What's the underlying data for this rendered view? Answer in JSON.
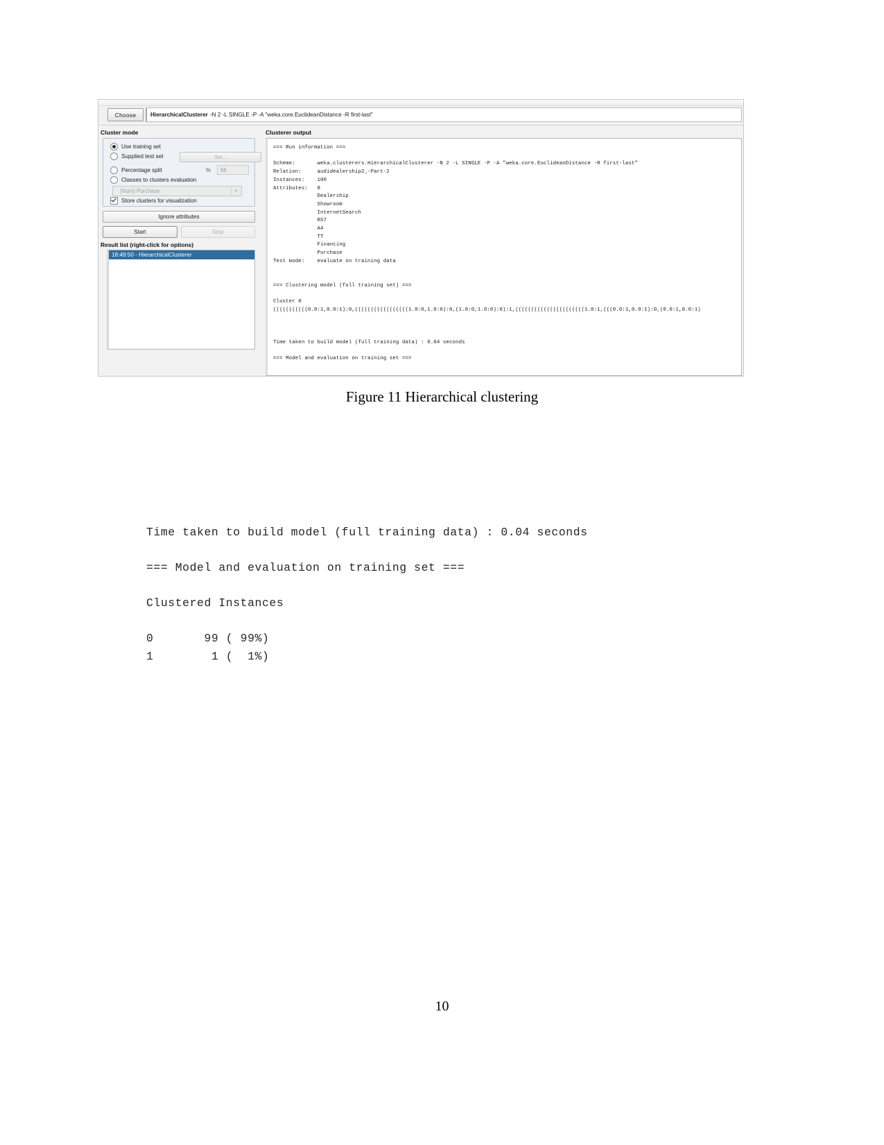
{
  "document": {
    "page_number": "10",
    "figure_caption": "Figure 11 Hierarchical clustering"
  },
  "weka": {
    "toolbar": {
      "choose_label": "Choose",
      "scheme_name": "HierarchicalClusterer",
      "scheme_options": "-N 2 -L SINGLE -P -A \"weka.core.EuclideanDistance -R first-last\""
    },
    "cluster_mode": {
      "title": "Cluster mode",
      "options": [
        {
          "label": "Use training set",
          "selected": true
        },
        {
          "label": "Supplied test set",
          "selected": false
        },
        {
          "label": "Percentage split",
          "selected": false
        },
        {
          "label": "Classes to clusters evaluation",
          "selected": false
        }
      ],
      "set_button": "Set...",
      "percent_symbol": "%",
      "percent_value": "66",
      "class_combo_value": "(Num) Purchase",
      "store_clusters_label": "Store clusters for visualization",
      "store_clusters_checked": true,
      "ignore_attributes_button": "Ignore attributes",
      "start_button": "Start",
      "stop_button": "Stop"
    },
    "result_list": {
      "title": "Result list (right-click for options)",
      "items": [
        "18:49:50 - HierarchicalClusterer"
      ]
    },
    "output": {
      "title": "Clusterer output",
      "text": "=== Run information ===\n\nScheme:       weka.clusterers.HierarchicalClusterer -N 2 -L SINGLE -P -A \"weka.core.EuclideanDistance -R first-last\"\nRelation:     audidealership2_-Part-2\nInstances:    100\nAttributes:   8\n              Dealership\n              Showroom\n              InternetSearch\n              RS7\n              A4\n              TT\n              Financing\n              Purchase\nTest mode:    evaluate on training data\n\n\n=== Clustering model (full training set) ===\n\nCluster 0\n(((((((((((0.0:1,0.0:1):0,(((((((((((((((((1.0:0,1.0:0):0,(1.0:0,1.0:0):0):1,((((((((((((((((((((((1.0:1,(((0.0:1,0.0:1):0,(0.0:1,0.0:1)\n\n\n\nTime taken to build model (full training data) : 0.04 seconds\n\n=== Model and evaluation on training set ==="
    }
  },
  "evaluation_excerpt": {
    "lines": [
      "Time taken to build model (full training data) : 0.04 seconds",
      "",
      "=== Model and evaluation on training set ===",
      "",
      "Clustered Instances",
      "",
      "0       99 ( 99%)",
      "1        1 (  1%)"
    ],
    "text": "Time taken to build model (full training data) : 0.04 seconds\n\n=== Model and evaluation on training set ===\n\nClustered Instances\n\n0       99 ( 99%)\n1        1 (  1%)"
  }
}
